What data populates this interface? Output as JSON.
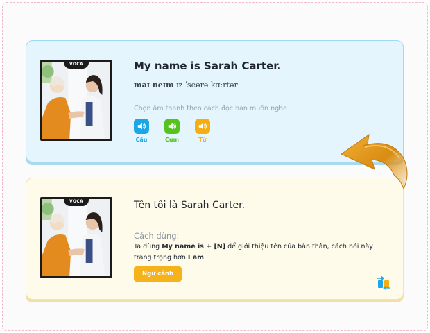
{
  "front": {
    "photo_tag": "VOCA",
    "sentence": "My name is Sarah Carter.",
    "ipa_bold": "maɪ neɪm",
    "ipa_rest": " ɪz ˈseərə kɑːrtər",
    "hint": "Chọn âm thanh theo cách đọc bạn muốn nghe",
    "audio_buttons": [
      {
        "label": "Câu",
        "color": "#1ba6e8"
      },
      {
        "label": "Cụm",
        "color": "#55c21e"
      },
      {
        "label": "Từ",
        "color": "#f5ad12"
      }
    ]
  },
  "back": {
    "photo_tag": "VOCA",
    "translation": "Tên tôi là Sarah Carter.",
    "usage_title": "Cách dùng:",
    "usage_parts": [
      "Ta dùng ",
      "My name is + [N]",
      " để giới thiệu tên của bản thân, cách nói này trang trọng hơn ",
      "I am",
      "."
    ],
    "context_button": "Ngữ cảnh"
  },
  "icons": {
    "flip_arrow": "curved-return-arrow-icon",
    "speaker": "speaker-icon",
    "flip_corner": "flip-card-icon"
  }
}
